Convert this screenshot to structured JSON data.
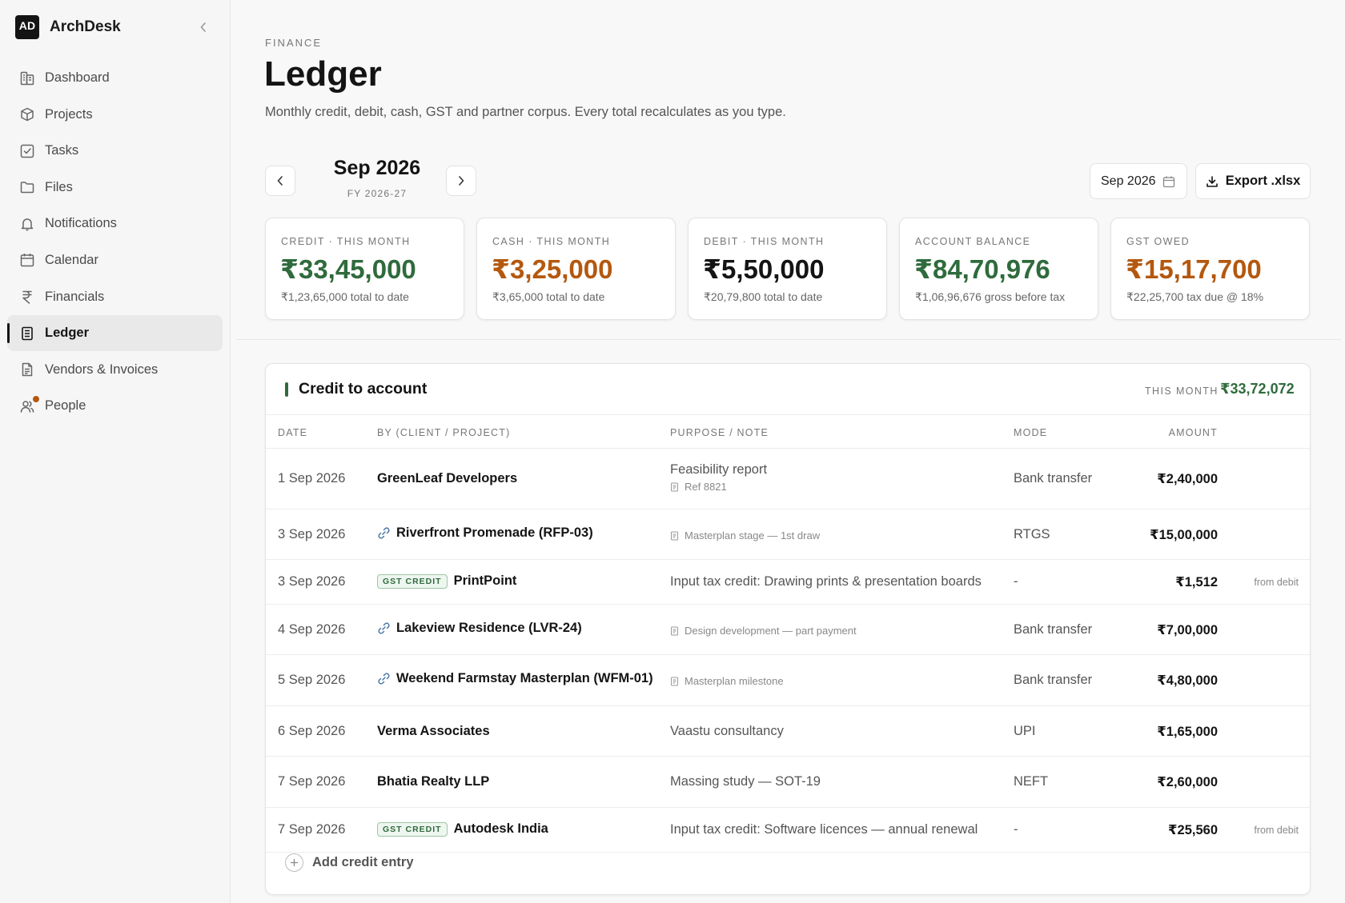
{
  "app": {
    "logo_text": "AD",
    "name": "ArchDesk"
  },
  "sidebar": {
    "items": [
      {
        "label": "Dashboard",
        "icon": "dashboard-icon"
      },
      {
        "label": "Projects",
        "icon": "box-icon"
      },
      {
        "label": "Tasks",
        "icon": "checkbox-icon"
      },
      {
        "label": "Files",
        "icon": "folder-icon"
      },
      {
        "label": "Notifications",
        "icon": "bell-icon"
      },
      {
        "label": "Calendar",
        "icon": "calendar-icon"
      },
      {
        "label": "Financials",
        "icon": "rupee-icon"
      },
      {
        "label": "Ledger",
        "icon": "ledger-icon",
        "active": true
      },
      {
        "label": "Vendors & Invoices",
        "icon": "invoice-icon"
      },
      {
        "label": "People",
        "icon": "people-icon",
        "badge_dot_color": "#b4580f"
      }
    ]
  },
  "header": {
    "eyebrow": "FINANCE",
    "title": "Ledger",
    "subtitle": "Monthly credit, debit, cash, GST and partner corpus. Every total recalculates as you type."
  },
  "period": {
    "month": "Sep 2026",
    "fy": "FY 2026-27",
    "date_picker_value": "Sep 2026",
    "export_label": "Export .xlsx"
  },
  "stats": [
    {
      "label": "CREDIT · THIS MONTH",
      "value": "₹33,45,000",
      "note": "₹1,23,65,000 total to date",
      "color": "green"
    },
    {
      "label": "CASH · THIS MONTH",
      "value": "₹3,25,000",
      "note": "₹3,65,000 total to date",
      "color": "orange"
    },
    {
      "label": "DEBIT · THIS MONTH",
      "value": "₹5,50,000",
      "note": "₹20,79,800 total to date",
      "color": "black"
    },
    {
      "label": "ACCOUNT BALANCE",
      "value": "₹84,70,976",
      "note": "₹1,06,96,676 gross before tax",
      "color": "green"
    },
    {
      "label": "GST OWED",
      "value": "₹15,17,700",
      "note": "₹22,25,700 tax due @ 18%",
      "color": "orange"
    }
  ],
  "credit": {
    "title": "Credit to account",
    "this_month_label": "THIS MONTH",
    "this_month_value": "₹33,72,072",
    "columns": {
      "date": "DATE",
      "by": "BY (CLIENT / PROJECT)",
      "purpose": "PURPOSE / NOTE",
      "mode": "MODE",
      "amount": "AMOUNT"
    },
    "rows": [
      {
        "date": "1 Sep 2026",
        "by": "GreenLeaf Developers",
        "purpose": "Feasibility report",
        "ref": "Ref 8821",
        "mode": "Bank transfer",
        "amount": "₹2,40,000"
      },
      {
        "date": "3 Sep 2026",
        "by": "Riverfront Promenade (RFP-03)",
        "linked": true,
        "purpose_small": "Masterplan stage — 1st draw",
        "mode": "RTGS",
        "amount": "₹15,00,000"
      },
      {
        "date": "3 Sep 2026",
        "tag": "GST CREDIT",
        "by": "PrintPoint",
        "purpose": "Input tax credit: Drawing prints & presentation boards",
        "mode": "-",
        "amount": "₹1,512",
        "extra": "from debit"
      },
      {
        "date": "4 Sep 2026",
        "by": "Lakeview Residence (LVR-24)",
        "linked": true,
        "purpose_small": "Design development — part payment",
        "mode": "Bank transfer",
        "amount": "₹7,00,000"
      },
      {
        "date": "5 Sep 2026",
        "by": "Weekend Farmstay Masterplan (WFM-01)",
        "linked": true,
        "purpose_small": "Masterplan milestone",
        "mode": "Bank transfer",
        "amount": "₹4,80,000"
      },
      {
        "date": "6 Sep 2026",
        "by": "Verma Associates",
        "purpose": "Vaastu consultancy",
        "mode": "UPI",
        "amount": "₹1,65,000"
      },
      {
        "date": "7 Sep 2026",
        "by": "Bhatia Realty LLP",
        "purpose": "Massing study — SOT-19",
        "mode": "NEFT",
        "amount": "₹2,60,000"
      },
      {
        "date": "7 Sep 2026",
        "tag": "GST CREDIT",
        "by": "Autodesk India",
        "purpose": "Input tax credit: Software licences — annual renewal",
        "mode": "-",
        "amount": "₹25,560",
        "extra": "from debit"
      }
    ],
    "add_label": "Add credit entry"
  }
}
